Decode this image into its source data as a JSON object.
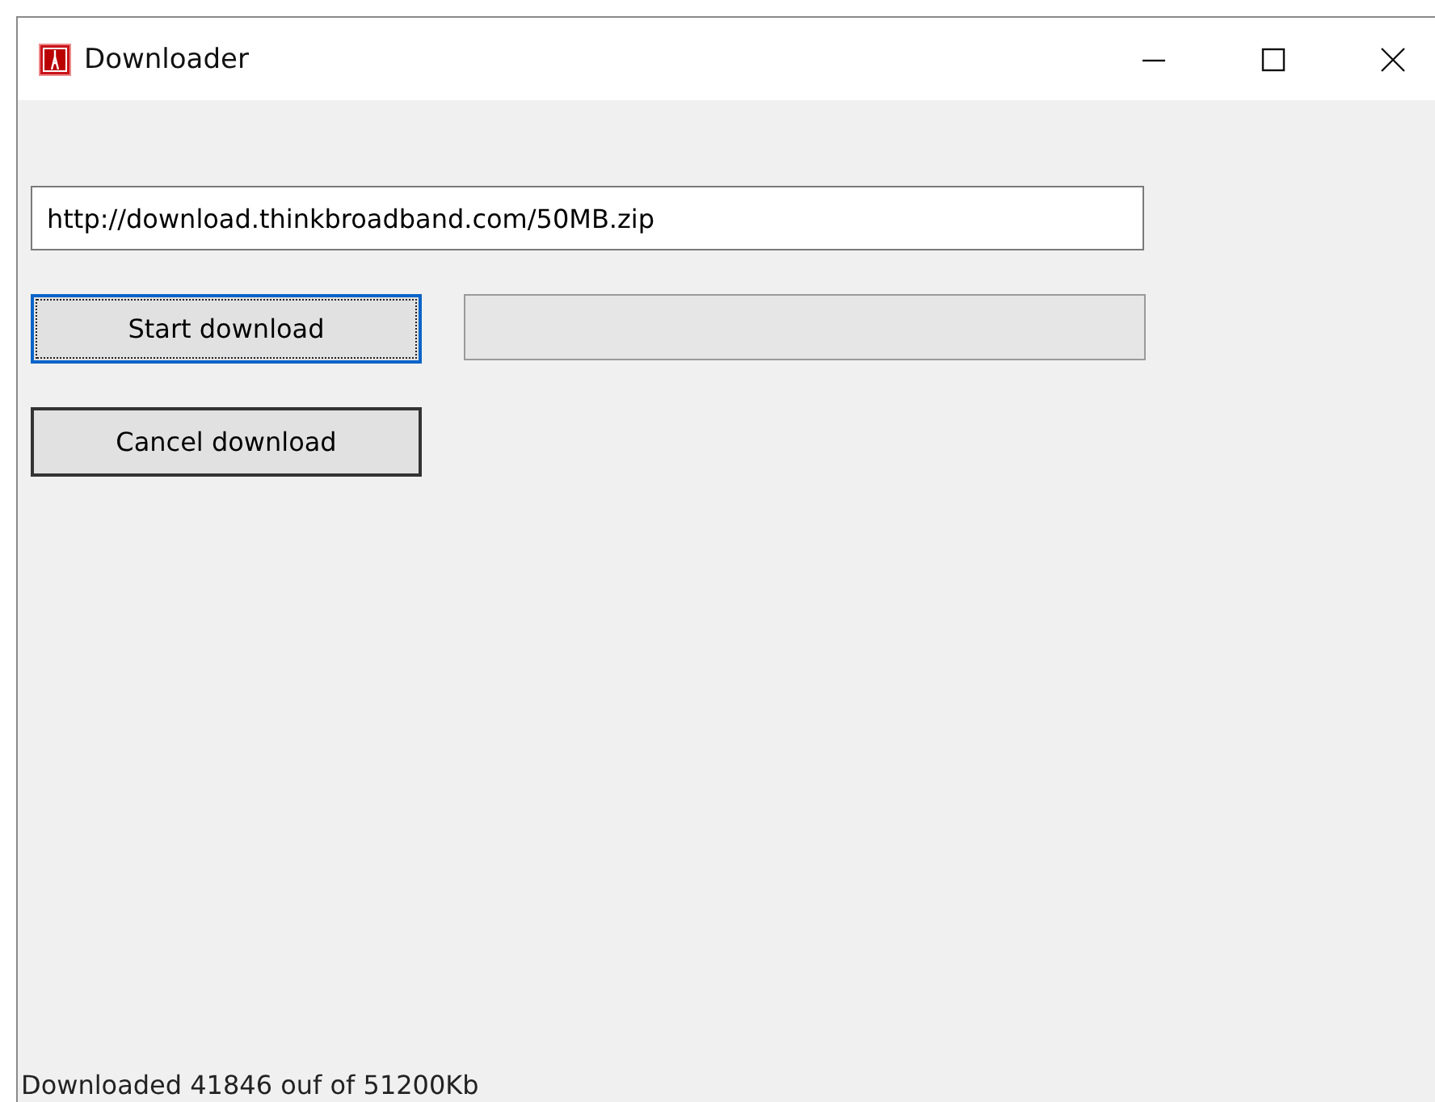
{
  "window": {
    "title": "Downloader"
  },
  "url_field": {
    "value": "http://download.thinkbroadband.com/50MB.zip"
  },
  "buttons": [
    {
      "label": "Start download",
      "focused": true
    },
    {
      "label": "Cancel download",
      "focused": false
    }
  ],
  "status_bar": {
    "text": "Downloaded 41846 ouf of 51200Kb"
  }
}
